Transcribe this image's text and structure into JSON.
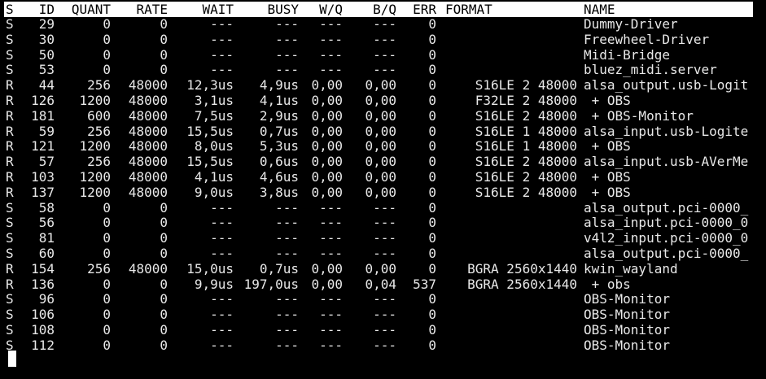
{
  "header": {
    "s": "S",
    "id": "ID",
    "quant": "QUANT",
    "rate": "RATE",
    "wait": "WAIT",
    "busy": "BUSY",
    "wq": "W/Q",
    "bq": "B/Q",
    "err": "ERR",
    "format": "FORMAT",
    "name": "NAME"
  },
  "rows": [
    {
      "s": "S",
      "id": "29",
      "quant": "0",
      "rate": "0",
      "wait": "---",
      "busy": "---",
      "wq": "---",
      "bq": "---",
      "err": "0",
      "format": "",
      "name": "Dummy-Driver"
    },
    {
      "s": "S",
      "id": "30",
      "quant": "0",
      "rate": "0",
      "wait": "---",
      "busy": "---",
      "wq": "---",
      "bq": "---",
      "err": "0",
      "format": "",
      "name": "Freewheel-Driver"
    },
    {
      "s": "S",
      "id": "50",
      "quant": "0",
      "rate": "0",
      "wait": "---",
      "busy": "---",
      "wq": "---",
      "bq": "---",
      "err": "0",
      "format": "",
      "name": "Midi-Bridge"
    },
    {
      "s": "S",
      "id": "53",
      "quant": "0",
      "rate": "0",
      "wait": "---",
      "busy": "---",
      "wq": "---",
      "bq": "---",
      "err": "0",
      "format": "",
      "name": "bluez_midi.server"
    },
    {
      "s": "R",
      "id": "44",
      "quant": "256",
      "rate": "48000",
      "wait": "12,3us",
      "busy": "4,9us",
      "wq": "0,00",
      "bq": "0,00",
      "err": "0",
      "format": "S16LE 2 48000",
      "name": "alsa_output.usb-Logit"
    },
    {
      "s": "R",
      "id": "126",
      "quant": "1200",
      "rate": "48000",
      "wait": "3,1us",
      "busy": "4,1us",
      "wq": "0,00",
      "bq": "0,00",
      "err": "0",
      "format": "F32LE 2 48000",
      "name": " + OBS"
    },
    {
      "s": "R",
      "id": "181",
      "quant": "600",
      "rate": "48000",
      "wait": "7,5us",
      "busy": "2,9us",
      "wq": "0,00",
      "bq": "0,00",
      "err": "0",
      "format": "S16LE 2 48000",
      "name": " + OBS-Monitor"
    },
    {
      "s": "R",
      "id": "59",
      "quant": "256",
      "rate": "48000",
      "wait": "15,5us",
      "busy": "0,7us",
      "wq": "0,00",
      "bq": "0,00",
      "err": "0",
      "format": "S16LE 1 48000",
      "name": "alsa_input.usb-Logite"
    },
    {
      "s": "R",
      "id": "121",
      "quant": "1200",
      "rate": "48000",
      "wait": "8,0us",
      "busy": "5,3us",
      "wq": "0,00",
      "bq": "0,00",
      "err": "0",
      "format": "S16LE 1 48000",
      "name": " + OBS"
    },
    {
      "s": "R",
      "id": "57",
      "quant": "256",
      "rate": "48000",
      "wait": "15,5us",
      "busy": "0,6us",
      "wq": "0,00",
      "bq": "0,00",
      "err": "0",
      "format": "S16LE 2 48000",
      "name": "alsa_input.usb-AVerMe"
    },
    {
      "s": "R",
      "id": "103",
      "quant": "1200",
      "rate": "48000",
      "wait": "4,1us",
      "busy": "4,6us",
      "wq": "0,00",
      "bq": "0,00",
      "err": "0",
      "format": "S16LE 2 48000",
      "name": " + OBS"
    },
    {
      "s": "R",
      "id": "137",
      "quant": "1200",
      "rate": "48000",
      "wait": "9,0us",
      "busy": "3,8us",
      "wq": "0,00",
      "bq": "0,00",
      "err": "0",
      "format": "S16LE 2 48000",
      "name": " + OBS"
    },
    {
      "s": "S",
      "id": "58",
      "quant": "0",
      "rate": "0",
      "wait": "---",
      "busy": "---",
      "wq": "---",
      "bq": "---",
      "err": "0",
      "format": "",
      "name": "alsa_output.pci-0000_"
    },
    {
      "s": "S",
      "id": "56",
      "quant": "0",
      "rate": "0",
      "wait": "---",
      "busy": "---",
      "wq": "---",
      "bq": "---",
      "err": "0",
      "format": "",
      "name": "alsa_input.pci-0000_0"
    },
    {
      "s": "S",
      "id": "81",
      "quant": "0",
      "rate": "0",
      "wait": "---",
      "busy": "---",
      "wq": "---",
      "bq": "---",
      "err": "0",
      "format": "",
      "name": "v4l2_input.pci-0000_0"
    },
    {
      "s": "S",
      "id": "60",
      "quant": "0",
      "rate": "0",
      "wait": "---",
      "busy": "---",
      "wq": "---",
      "bq": "---",
      "err": "0",
      "format": "",
      "name": "alsa_output.pci-0000_"
    },
    {
      "s": "R",
      "id": "154",
      "quant": "256",
      "rate": "48000",
      "wait": "15,0us",
      "busy": "0,7us",
      "wq": "0,00",
      "bq": "0,00",
      "err": "0",
      "format": "BGRA 2560x1440",
      "name": "kwin_wayland"
    },
    {
      "s": "R",
      "id": "136",
      "quant": "0",
      "rate": "0",
      "wait": "9,9us",
      "busy": "197,0us",
      "wq": "0,00",
      "bq": "0,04",
      "err": "537",
      "format": "BGRA 2560x1440",
      "name": " + obs"
    },
    {
      "s": "S",
      "id": "96",
      "quant": "0",
      "rate": "0",
      "wait": "---",
      "busy": "---",
      "wq": "---",
      "bq": "---",
      "err": "0",
      "format": "",
      "name": "OBS-Monitor"
    },
    {
      "s": "S",
      "id": "106",
      "quant": "0",
      "rate": "0",
      "wait": "---",
      "busy": "---",
      "wq": "---",
      "bq": "---",
      "err": "0",
      "format": "",
      "name": "OBS-Monitor"
    },
    {
      "s": "S",
      "id": "108",
      "quant": "0",
      "rate": "0",
      "wait": "---",
      "busy": "---",
      "wq": "---",
      "bq": "---",
      "err": "0",
      "format": "",
      "name": "OBS-Monitor"
    },
    {
      "s": "S",
      "id": "112",
      "quant": "0",
      "rate": "0",
      "wait": "---",
      "busy": "---",
      "wq": "---",
      "bq": "---",
      "err": "0",
      "format": "",
      "name": "OBS-Monitor"
    }
  ]
}
